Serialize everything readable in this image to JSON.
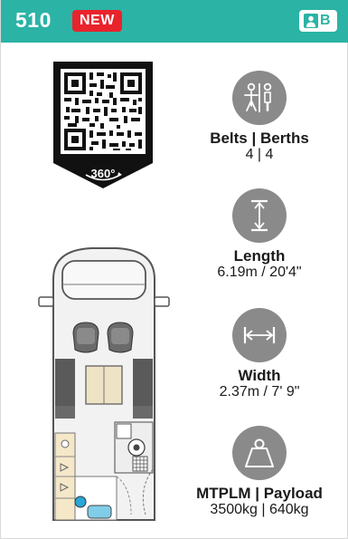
{
  "header": {
    "model": "510",
    "badge": "NEW",
    "berth_letter": "B",
    "colors": {
      "header_bg": "#2bb3a5",
      "badge_bg": "#e8232c"
    }
  },
  "qr": {
    "caption": "360°",
    "icon": "qr-code-360-icon"
  },
  "specs": [
    {
      "icon": "belts-berths-icon",
      "label": "Belts | Berths",
      "value": "4 | 4"
    },
    {
      "icon": "length-icon",
      "label": "Length",
      "value": "6.19m / 20'4\""
    },
    {
      "icon": "width-icon",
      "label": "Width",
      "value": "2.37m / 7' 9\""
    },
    {
      "icon": "weight-icon",
      "label": "MTPLM | Payload",
      "value": "3500kg | 640kg"
    }
  ],
  "floorplan": {
    "icon": "motorhome-floorplan-icon"
  }
}
